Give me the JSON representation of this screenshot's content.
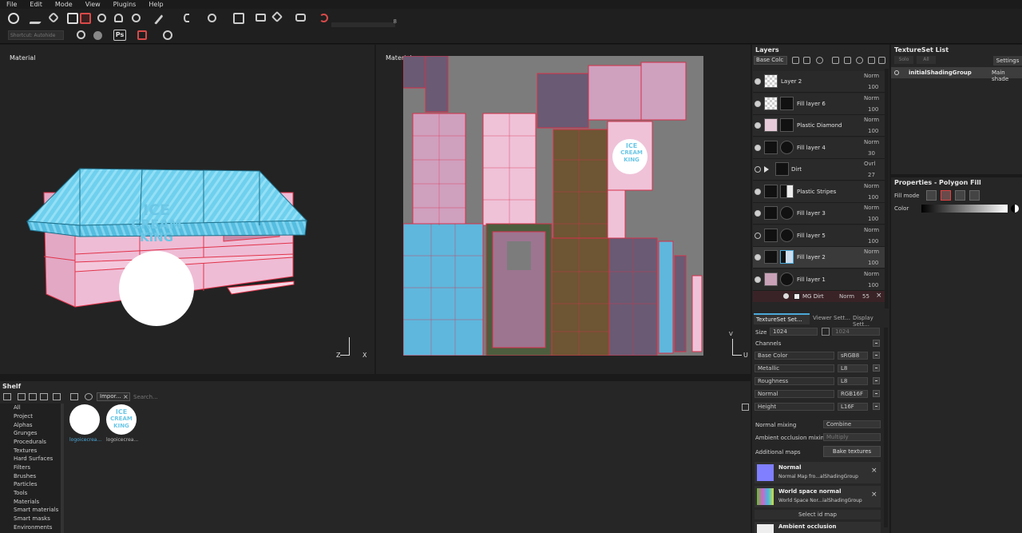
{
  "menu": [
    "File",
    "Edit",
    "Mode",
    "View",
    "Plugins",
    "Help"
  ],
  "toolbar": {
    "brush_size_value": "8",
    "search_placeholder": "Shortcut: Autohide"
  },
  "viewport3d": {
    "label": "Material",
    "axis_x": "X",
    "axis_z": "Z"
  },
  "viewport2d": {
    "label": "Material",
    "axis_u": "U",
    "axis_v": "V"
  },
  "decal_text": {
    "line1": "ICE",
    "line2": "CREAM",
    "line3": "KING"
  },
  "layers_panel": {
    "title": "Layers",
    "channel_select": "Base Colc",
    "items": [
      {
        "name": "Layer 2",
        "blend": "Norm",
        "opacity": "100"
      },
      {
        "name": "Fill layer 6",
        "blend": "Norm",
        "opacity": "100"
      },
      {
        "name": "Plastic Diamond",
        "blend": "Norm",
        "opacity": "100"
      },
      {
        "name": "Fill layer 4",
        "blend": "Norm",
        "opacity": "30"
      },
      {
        "name": "Dirt",
        "blend": "Ovrl",
        "opacity": "27"
      },
      {
        "name": "Plastic Stripes",
        "blend": "Norm",
        "opacity": "100"
      },
      {
        "name": "Fill layer 3",
        "blend": "Norm",
        "opacity": "100"
      },
      {
        "name": "Fill layer 5",
        "blend": "Norm",
        "opacity": "100"
      },
      {
        "name": "Fill layer 2",
        "blend": "Norm",
        "opacity": "100"
      },
      {
        "name": "Fill layer 1",
        "blend": "Norm",
        "opacity": "100"
      }
    ],
    "effect": {
      "name": "MG Dirt",
      "blend": "Norm",
      "opacity": "55"
    }
  },
  "textureset_list": {
    "title": "TextureSet List",
    "solo": "Solo",
    "all": "All",
    "settings": "Settings",
    "set_name": "initialShadingGroup",
    "shader": "Main shade"
  },
  "properties": {
    "title": "Properties - Polygon Fill",
    "fill_mode_label": "Fill mode",
    "color_label": "Color"
  },
  "tss": {
    "tabs": [
      "TextureSet Set...",
      "Viewer Sett...",
      "Display Sett..."
    ],
    "size_label": "Size",
    "size_value": "1024",
    "size_value2": "1024",
    "channels_label": "Channels",
    "channels": [
      {
        "name": "Base Color",
        "format": "sRGB8"
      },
      {
        "name": "Metallic",
        "format": "L8"
      },
      {
        "name": "Roughness",
        "format": "L8"
      },
      {
        "name": "Normal",
        "format": "RGB16F"
      },
      {
        "name": "Height",
        "format": "L16F"
      }
    ],
    "normal_mixing_label": "Normal mixing",
    "normal_mixing_value": "Combine",
    "ao_mixing_label": "Ambient occlusion mixing",
    "ao_mixing_value": "Multiply",
    "additional_maps_label": "Additional maps",
    "bake_button": "Bake textures",
    "maps": [
      {
        "title": "Normal",
        "subtitle": "Normal Map fro...alShadingGroup"
      },
      {
        "title": "World space normal",
        "subtitle": "World Space Nor...ialShadingGroup"
      }
    ],
    "select_id_map": "Select id map",
    "ao_map_title": "Ambient occlusion"
  },
  "shelf": {
    "title": "Shelf",
    "tab_label": "Impor...",
    "search_placeholder": "Search...",
    "categories": [
      "All",
      "Project",
      "Alphas",
      "Grunges",
      "Procedurals",
      "Textures",
      "Hard Surfaces",
      "Filters",
      "Brushes",
      "Particles",
      "Tools",
      "Materials",
      "Smart materials",
      "Smart masks",
      "Environments"
    ],
    "items": [
      {
        "label": "logoicecrea..."
      },
      {
        "label": "logoicecrea..."
      }
    ]
  }
}
